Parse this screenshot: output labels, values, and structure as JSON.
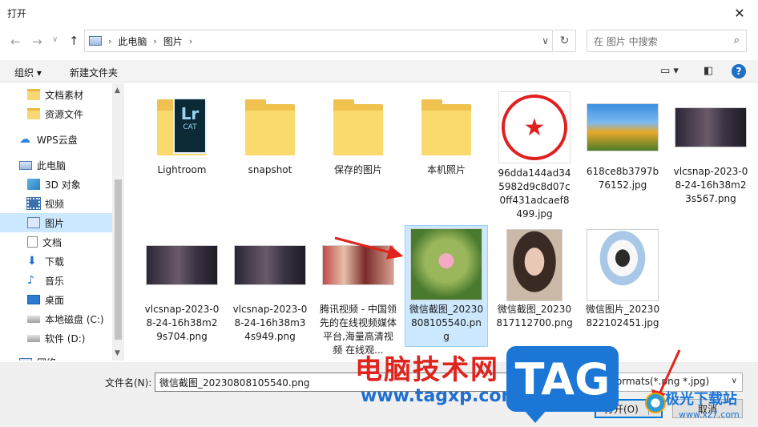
{
  "window": {
    "title": "打开",
    "close_icon": "close-icon"
  },
  "nav": {
    "breadcrumb": [
      "此电脑",
      "图片"
    ],
    "search_placeholder": "在 图片 中搜索"
  },
  "toolbar": {
    "organize": "组织 ▾",
    "new_folder": "新建文件夹",
    "help": "?"
  },
  "sidebar": {
    "items": [
      {
        "label": "文档素材",
        "icon": "folder-icon"
      },
      {
        "label": "资源文件",
        "icon": "folder-icon"
      },
      {
        "label": "WPS云盘",
        "icon": "cloud-icon"
      },
      {
        "label": "此电脑",
        "icon": "computer-icon"
      },
      {
        "label": "3D 对象",
        "icon": "3d-objects-icon"
      },
      {
        "label": "视频",
        "icon": "video-icon"
      },
      {
        "label": "图片",
        "icon": "pictures-icon",
        "selected": true
      },
      {
        "label": "文档",
        "icon": "document-icon"
      },
      {
        "label": "下载",
        "icon": "download-icon"
      },
      {
        "label": "音乐",
        "icon": "music-icon"
      },
      {
        "label": "桌面",
        "icon": "desktop-icon"
      },
      {
        "label": "本地磁盘 (C:)",
        "icon": "drive-icon"
      },
      {
        "label": "软件 (D:)",
        "icon": "drive-icon"
      },
      {
        "label": "网络",
        "icon": "network-icon"
      }
    ]
  },
  "files": [
    {
      "name": "Lightroom",
      "kind": "folder",
      "badge": "Lr",
      "badge_sub": "CAT"
    },
    {
      "name": "snapshot",
      "kind": "folder"
    },
    {
      "name": "保存的图片",
      "kind": "folder"
    },
    {
      "name": "本机照片",
      "kind": "folder"
    },
    {
      "name": "96dda144ad345982d9c8d07c0ff431adcaef8499.jpg",
      "kind": "stamp"
    },
    {
      "name": "618ce8b3797b76152.jpg",
      "kind": "tulips"
    },
    {
      "name": "vlcsnap-2023-08-24-16h38m23s567.png",
      "kind": "dark"
    },
    {
      "name": "vlcsnap-2023-08-24-16h38m29s704.png",
      "kind": "dark"
    },
    {
      "name": "vlcsnap-2023-08-24-16h38m34s949.png",
      "kind": "dark"
    },
    {
      "name": "腾讯视频 - 中国领先的在线视频媒体平台,海量高清视频 在线观...",
      "kind": "tencent"
    },
    {
      "name": "微信截图_20230808105540.png",
      "kind": "lotus",
      "selected": true
    },
    {
      "name": "微信截图_20230817112700.png",
      "kind": "portrait"
    },
    {
      "name": "微信图片_20230822102451.jpg",
      "kind": "drawing"
    }
  ],
  "bottom": {
    "filename_label": "文件名(N):",
    "filename_value": "微信截图_20230808105540.png",
    "filetype_value": "All formats(*.png *.jpg)",
    "open_label": "打开(O)",
    "cancel_label": "取消"
  },
  "watermark": {
    "site_cn": "电脑技术网",
    "site_url": "www.tagxp.com",
    "tag": "TAG",
    "brand2": "极光下载站",
    "brand2_url": "www.xz7.com"
  },
  "colors": {
    "selection": "#cce8ff",
    "accent": "#0078d7",
    "arrow": "#e0231d"
  }
}
